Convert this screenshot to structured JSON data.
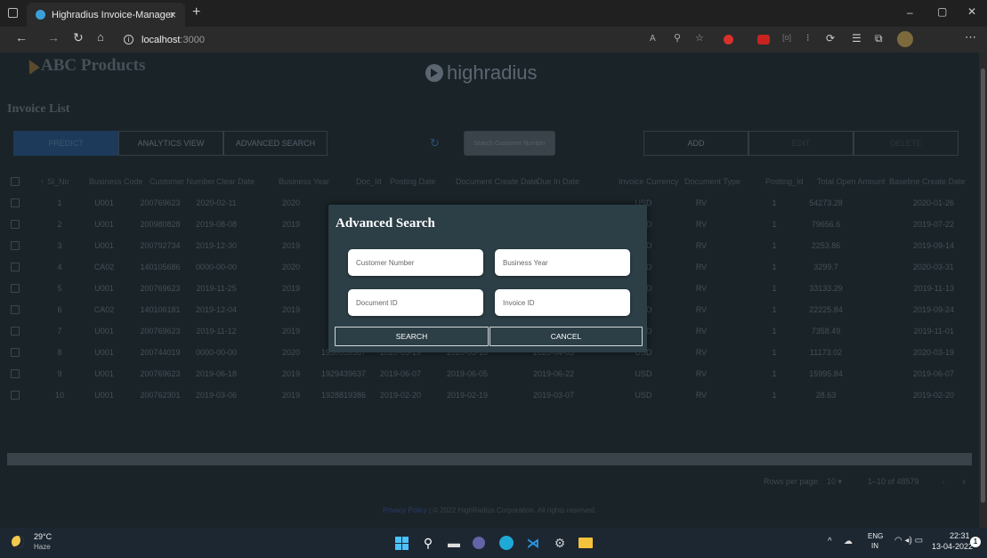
{
  "browser": {
    "tab_title": "Highradius Invoice-Manager",
    "tab_close": "×",
    "new_tab": "+",
    "url_host": "localhost",
    "url_port": ":3000",
    "window_controls": [
      "–",
      "▢",
      "✕"
    ]
  },
  "header": {
    "brand_left": "ABC Products",
    "brand_center": "highradius"
  },
  "page_title": "Invoice List",
  "toolbar": {
    "predict": "PREDICT",
    "analytics": "ANALYTICS VIEW",
    "advanced_search": "ADVANCED SEARCH",
    "search_placeholder": "Search Customer Number",
    "add": "ADD",
    "edit": "EDIT",
    "delete": "DELETE"
  },
  "table": {
    "columns": [
      "Sl_No",
      "Business Code",
      "Customer Number",
      "Clear Date",
      "Business Year",
      "Doc_Id",
      "Posting Date",
      "Document Create Date",
      "Due In Date",
      "Invoice Currency",
      "Document Type",
      "Posting_Id",
      "Total Open Amount",
      "Baseline Create Date"
    ],
    "sort_arrow": "↑",
    "rows": [
      [
        "1",
        "U001",
        "200769623",
        "2020-02-11",
        "2020",
        "",
        "",
        "",
        "",
        "USD",
        "RV",
        "1",
        "54273.28",
        "2020-01-26"
      ],
      [
        "2",
        "U001",
        "200980828",
        "2019-08-08",
        "2019",
        "",
        "",
        "",
        "",
        "USD",
        "RV",
        "1",
        "79656.6",
        "2019-07-22"
      ],
      [
        "3",
        "U001",
        "200792734",
        "2019-12-30",
        "2019",
        "",
        "",
        "",
        "",
        "USD",
        "RV",
        "1",
        "2253.86",
        "2019-09-14"
      ],
      [
        "4",
        "CA02",
        "140105686",
        "0000-00-00",
        "2020",
        "",
        "",
        "",
        "",
        "CAD",
        "RV",
        "1",
        "3299.7",
        "2020-03-31"
      ],
      [
        "5",
        "U001",
        "200769623",
        "2019-11-25",
        "2019",
        "",
        "",
        "",
        "",
        "USD",
        "RV",
        "1",
        "33133.29",
        "2019-11-13"
      ],
      [
        "6",
        "CA02",
        "140106181",
        "2019-12-04",
        "2019",
        "",
        "",
        "",
        "",
        "CAD",
        "RV",
        "1",
        "22225.84",
        "2019-09-24"
      ],
      [
        "7",
        "U001",
        "200769623",
        "2019-11-12",
        "2019",
        "",
        "",
        "",
        "",
        "USD",
        "RV",
        "1",
        "7358.49",
        "2019-11-01"
      ],
      [
        "8",
        "U001",
        "200744019",
        "0000-00-00",
        "2020",
        "1930659387",
        "2020-03-19",
        "2020-03-18",
        "2020-04-03",
        "USD",
        "RV",
        "1",
        "11173.02",
        "2020-03-19"
      ],
      [
        "9",
        "U001",
        "200769623",
        "2019-06-18",
        "2019",
        "1929439637",
        "2019-06-07",
        "2019-06-05",
        "2019-06-22",
        "USD",
        "RV",
        "1",
        "15995.84",
        "2019-06-07"
      ],
      [
        "10",
        "U001",
        "200762301",
        "2019-03-06",
        "2019",
        "1928819386",
        "2019-02-20",
        "2019-02-19",
        "2019-03-07",
        "USD",
        "RV",
        "1",
        "28.63",
        "2019-02-20"
      ]
    ]
  },
  "pagination": {
    "rows_label": "Rows per page:",
    "rows_value": "10",
    "range": "1–10 of 48579"
  },
  "footer": {
    "link": "Privacy Policy",
    "text": " | © 2022 HighRadius Corporation. All rights reserved."
  },
  "modal": {
    "title": "Advanced Search",
    "customer_number": "Customer Number",
    "business_year": "Business Year",
    "document_id": "Document ID",
    "invoice_id": "Invoice ID",
    "search": "SEARCH",
    "cancel": "CANCEL"
  },
  "taskbar": {
    "temp": "29°C",
    "weather": "Haze",
    "lang1": "ENG",
    "lang2": "IN",
    "time": "22:31",
    "date": "13-04-2022"
  }
}
